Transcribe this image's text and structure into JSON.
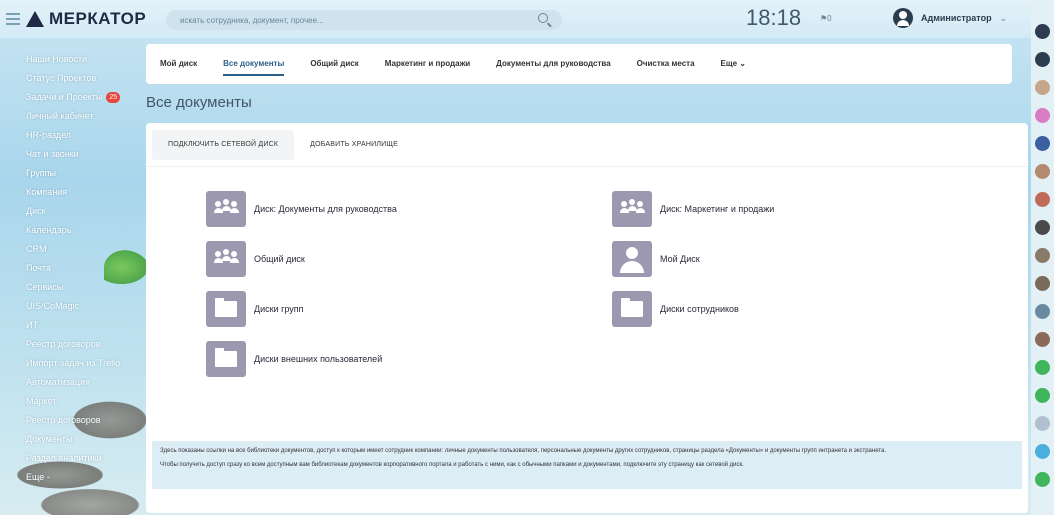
{
  "app": {
    "logo_text": "МЕРКАТОР",
    "search_placeholder": "искать сотрудника, документ, прочее...",
    "time": "18:18",
    "time_flag": "⚑0",
    "user_name": "Администратор",
    "user_dropdown": "⌄"
  },
  "sidebar": {
    "items": [
      {
        "label": "Наши Новости"
      },
      {
        "label": "Статус Проектов"
      },
      {
        "label": "Задачи и Проекты",
        "badge": "25"
      },
      {
        "label": "Личный кабинет"
      },
      {
        "label": "HR-раздел"
      },
      {
        "label": "Чат и звонки"
      },
      {
        "label": "Группы"
      },
      {
        "label": "Компания"
      },
      {
        "label": "Диск"
      },
      {
        "label": "Календарь"
      },
      {
        "label": "CRM"
      },
      {
        "label": "Почта"
      },
      {
        "label": "Сервисы"
      },
      {
        "label": "UIS/CoMagic"
      },
      {
        "label": "ИТ"
      },
      {
        "label": "Реестр договоров"
      },
      {
        "label": "Импорт задач из Trello"
      },
      {
        "label": "Автоматизация"
      },
      {
        "label": "Маркет"
      },
      {
        "label": "Реестр договоров"
      },
      {
        "label": "Документы"
      },
      {
        "label": "Раздел аналитики"
      },
      {
        "label": "Еще -"
      }
    ]
  },
  "tabs": [
    {
      "label": "Мой диск",
      "active": false
    },
    {
      "label": "Все документы",
      "active": true
    },
    {
      "label": "Общий диск",
      "active": false
    },
    {
      "label": "Маркетинг и продажи",
      "active": false
    },
    {
      "label": "Документы для руководства",
      "active": false
    },
    {
      "label": "Очистка места",
      "active": false
    },
    {
      "label": "Еще ⌄",
      "active": false
    }
  ],
  "page": {
    "title": "Все документы",
    "star": "☆"
  },
  "actions": {
    "connect": "Подключить сетевой диск",
    "add_storage": "Добавить хранилище"
  },
  "disks": [
    {
      "label": "Диск: Документы для руководства",
      "icon": "group-icon"
    },
    {
      "label": "Диск: Маркетинг и продажи",
      "icon": "group-icon"
    },
    {
      "label": "Общий диск",
      "icon": "group-icon"
    },
    {
      "label": "Мой Диск",
      "icon": "user-icon"
    },
    {
      "label": "Диски групп",
      "icon": "folder-icon"
    },
    {
      "label": "Диски сотрудников",
      "icon": "folder-icon"
    },
    {
      "label": "Диски внешних пользователей",
      "icon": "folder-icon"
    }
  ],
  "info": {
    "line1": "Здесь показаны ссылки на все библиотеки документов, доступ к которым имеет сотрудник компании: личные документы пользователя, персональные документы других сотрудников, страницы раздела «Документы» и документы групп интранета и экстранета.",
    "line2": "Чтобы получить доступ сразу ко всем доступным вам библиотекам документов корпоративного портала и работать с ними, как с обычными папками и документами, подключите эту страницу как сетевой диск."
  },
  "rail": {
    "colors": [
      "#2b3d4f",
      "#2b3d4f",
      "#c7a58a",
      "#d87cc4",
      "#3b5fa0",
      "#b38a6e",
      "#c06a5a",
      "#4a4a4a",
      "#8a7a6a",
      "#7a6a5a",
      "#6a8aa0",
      "#8a6a5a",
      "#3fb55c",
      "#3fb55c",
      "#b0c0d0",
      "#4aaede",
      "#3fb55c"
    ]
  }
}
